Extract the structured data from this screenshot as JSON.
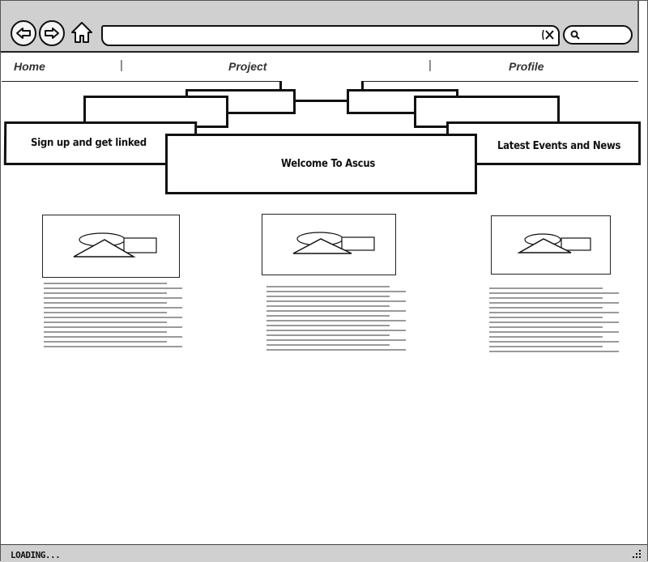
{
  "menu": {
    "home": "Home",
    "project": "Project",
    "profile": "Profile",
    "separator": "|"
  },
  "hero": {
    "left_tab": "Sign up and get linked",
    "center_tab": "Welcome To Ascus",
    "right_tab": "Latest Events and News"
  },
  "status": {
    "text": "LOADING..."
  },
  "icons": {
    "back": "back-arrow-icon",
    "forward": "forward-arrow-icon",
    "home": "home-icon",
    "clear": "clear-x-icon",
    "search": "search-icon",
    "image": "image-placeholder-icon",
    "resize": "resize-grip-icon"
  }
}
